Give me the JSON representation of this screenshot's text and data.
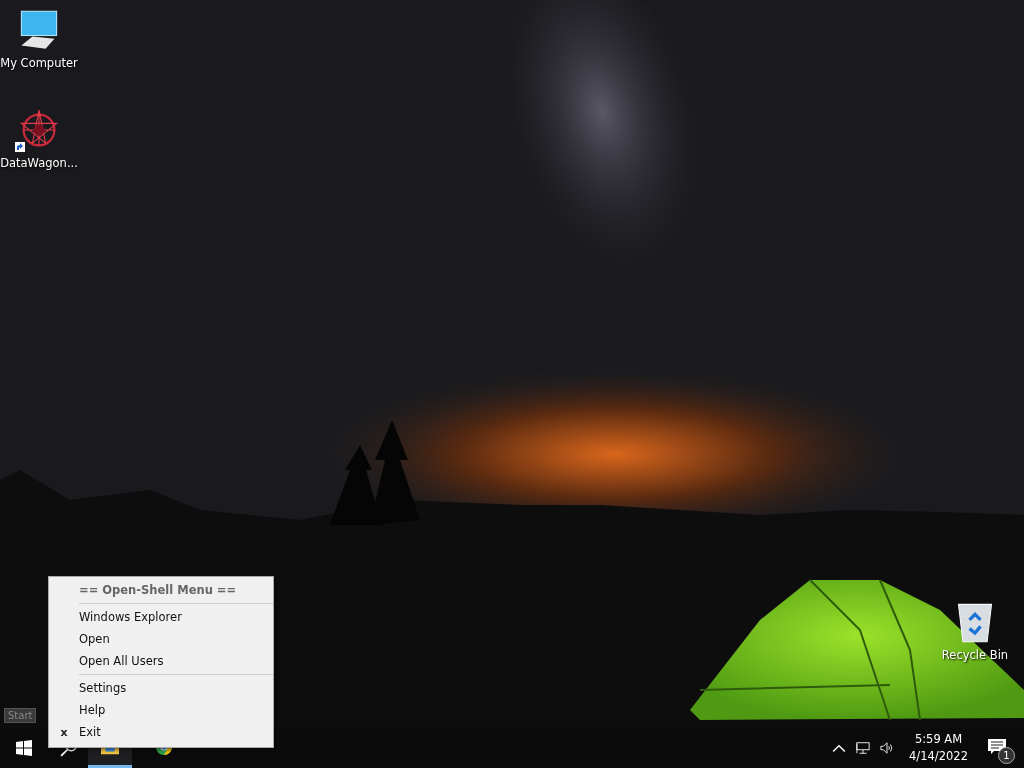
{
  "desktop_icons": [
    {
      "kind": "computer",
      "label": "My Computer",
      "shortcut": false
    },
    {
      "kind": "star",
      "label": "DataWagon...",
      "shortcut": true
    }
  ],
  "recycle_bin": {
    "label": "Recycle Bin"
  },
  "tooltip": {
    "text": "Start"
  },
  "context_menu": {
    "items": [
      {
        "kind": "header",
        "label": "== Open-Shell Menu =="
      },
      {
        "kind": "separator"
      },
      {
        "kind": "item",
        "label": "Windows Explorer"
      },
      {
        "kind": "item",
        "label": "Open"
      },
      {
        "kind": "item",
        "label": "Open All Users"
      },
      {
        "kind": "separator"
      },
      {
        "kind": "item",
        "label": "Settings"
      },
      {
        "kind": "item",
        "label": "Help"
      },
      {
        "kind": "item",
        "label": "Exit",
        "marker": "x"
      }
    ]
  },
  "taskbar": {
    "apps": [
      {
        "kind": "explorer",
        "active": true
      },
      {
        "kind": "chrome",
        "active": false
      }
    ],
    "clock": {
      "time": "5:59 AM",
      "date": "4/14/2022"
    },
    "notification_count": "1"
  }
}
